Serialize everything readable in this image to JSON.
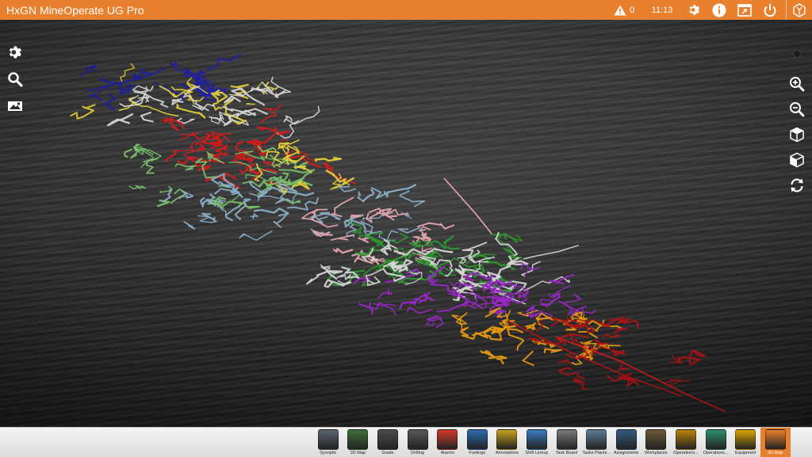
{
  "app": {
    "title": "HxGN MineOperate UG Pro"
  },
  "status": {
    "alerts_count": "0",
    "time": "11:13"
  },
  "topbar_icons": [
    "warning-icon",
    "settings-icon",
    "info-icon",
    "window-export-icon",
    "power-icon",
    "hexagon-logo-icon"
  ],
  "left_tools": [
    "settings-icon",
    "search-icon",
    "map-layers-icon"
  ],
  "right_tools": [
    "zoom-in-icon",
    "zoom-out-icon",
    "cube-view-icon",
    "cube-side-view-icon",
    "reset-view-icon"
  ],
  "modules": [
    {
      "label": "Synoptic",
      "icon": "monitor-icon",
      "color": "#5a6670"
    },
    {
      "label": "2D Map",
      "icon": "map2d-icon",
      "color": "#3f6f3a"
    },
    {
      "label": "Grade",
      "icon": "grade-icon",
      "color": "#4c4c4c"
    },
    {
      "label": "Drilling",
      "icon": "drilling-icon",
      "color": "#585858"
    },
    {
      "label": "Alarms",
      "icon": "alarm-icon",
      "color": "#d43b2a"
    },
    {
      "label": "Fuelings",
      "icon": "fuel-icon",
      "color": "#2b6cb0"
    },
    {
      "label": "Annotations",
      "icon": "annotation-icon",
      "color": "#c9a21d"
    },
    {
      "label": "Shift Lineup",
      "icon": "calendar-icon",
      "color": "#3a7bbf"
    },
    {
      "label": "Task Board",
      "icon": "taskboard-icon",
      "color": "#7a7a7a"
    },
    {
      "label": "Tasks Planni...",
      "icon": "tasks-planning-icon",
      "color": "#5f7d95"
    },
    {
      "label": "Assignments",
      "icon": "assignment-icon",
      "color": "#345b82"
    },
    {
      "label": "Workplaces",
      "icon": "workplace-icon",
      "color": "#6b5a3a"
    },
    {
      "label": "Operations...",
      "icon": "operations-icon",
      "color": "#b8860b"
    },
    {
      "label": "Operations...",
      "icon": "operations2-icon",
      "color": "#2f8f6a"
    },
    {
      "label": "Equipment",
      "icon": "equipment-icon",
      "color": "#d9a600"
    },
    {
      "label": "3D Map",
      "icon": "map3d-icon",
      "color": "#e9802d",
      "active": true
    }
  ],
  "colors": {
    "accent": "#e9802d",
    "tunnel_colors": [
      "#1f1fa8",
      "#e6d23a",
      "#d8d8d8",
      "#d41c1c",
      "#7ac36b",
      "#8db0c9",
      "#2e9a2e",
      "#e7a6b0",
      "#9b27c9",
      "#e89a12",
      "#b01515"
    ]
  }
}
